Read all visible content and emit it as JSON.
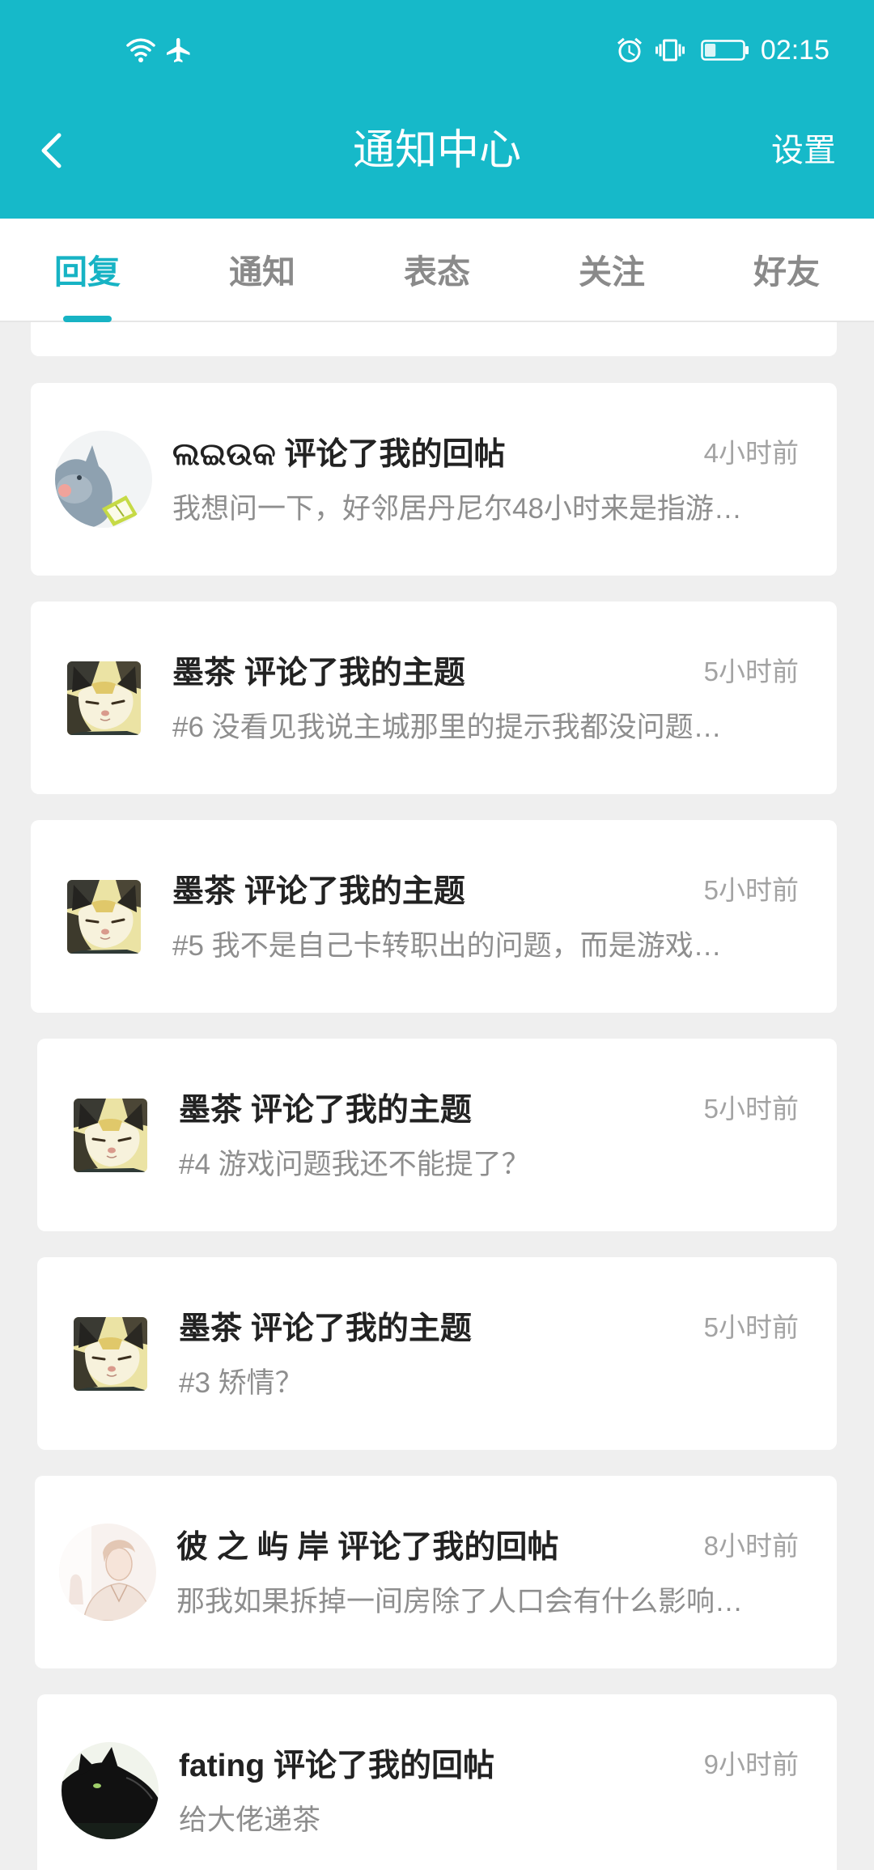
{
  "status_bar": {
    "time": "02:15",
    "left_icons": [
      "wifi-icon",
      "airplane-mode-icon"
    ],
    "right_icons": [
      "alarm-icon",
      "vibrate-icon",
      "battery-icon"
    ],
    "battery_level": 0.3
  },
  "header": {
    "back_icon": "chevron-left-icon",
    "title": "通知中心",
    "settings_label": "设置"
  },
  "colors": {
    "accent": "#16b9c9",
    "active_tab": "#17b3c4",
    "background": "#efefef"
  },
  "tabs": {
    "active_index": 0,
    "items": [
      {
        "label": "回复"
      },
      {
        "label": "通知"
      },
      {
        "label": "表态"
      },
      {
        "label": "关注"
      },
      {
        "label": "好友"
      }
    ]
  },
  "notifications": [
    {
      "avatar": "bird-cartoon-avatar",
      "name": "ଲଇଉକ",
      "action": "评论了我的回帖",
      "time": "4小时前",
      "preview": "我想问一下，好邻居丹尼尔48小时来是指游…"
    },
    {
      "avatar": "cat-photo-avatar",
      "name": "墨茶",
      "action": "评论了我的主题",
      "time": "5小时前",
      "preview": "#6 没看见我说主城那里的提示我都没问题…"
    },
    {
      "avatar": "cat-photo-avatar",
      "name": "墨茶",
      "action": "评论了我的主题",
      "time": "5小时前",
      "preview": "#5 我不是自己卡转职出的问题，而是游戏…"
    },
    {
      "avatar": "cat-photo-avatar",
      "name": "墨茶",
      "action": "评论了我的主题",
      "time": "5小时前",
      "preview": "#4 游戏问题我还不能提了？"
    },
    {
      "avatar": "cat-photo-avatar",
      "name": "墨茶",
      "action": "评论了我的主题",
      "time": "5小时前",
      "preview": "#3 矫情？"
    },
    {
      "avatar": "sketch-person-avatar",
      "name": "彼 之 屿 岸",
      "action": "评论了我的回帖",
      "time": "8小时前",
      "preview": "那我如果拆掉一间房除了人口会有什么影响…"
    },
    {
      "avatar": "black-cat-avatar",
      "name": "fating",
      "action": "评论了我的回帖",
      "time": "9小时前",
      "preview": "给大佬递茶"
    }
  ]
}
